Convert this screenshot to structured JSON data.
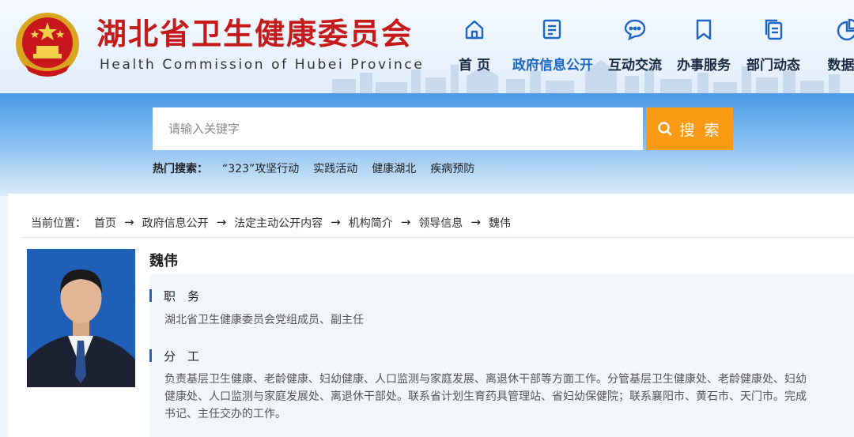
{
  "header": {
    "title_cn": "湖北省卫生健康委员会",
    "title_en": "Health Commission of Hubei Province",
    "brand_color": "#c41a1a"
  },
  "nav": {
    "items": [
      {
        "label": "首 页",
        "icon": "home-icon"
      },
      {
        "label": "政府信息公开",
        "icon": "document-icon",
        "active": true
      },
      {
        "label": "互动交流",
        "icon": "chat-icon"
      },
      {
        "label": "办事服务",
        "icon": "bookmark-icon"
      },
      {
        "label": "部门动态",
        "icon": "copy-icon"
      },
      {
        "label": "数据开",
        "icon": "pie-chart-icon"
      }
    ],
    "accent_color": "#1d66c6"
  },
  "search": {
    "placeholder": "请输入关键字",
    "button_label": "搜 索",
    "button_color": "#fa9a14",
    "hot_label": "热门搜索：",
    "hot_terms": [
      "“323”攻坚行动",
      "实践活动",
      "健康湖北",
      "疾病预防"
    ]
  },
  "breadcrumb": {
    "label": "当前位置：",
    "items": [
      "首页",
      "政府信息公开",
      "法定主动公开内容",
      "机构简介",
      "领导信息",
      "魏伟"
    ]
  },
  "profile": {
    "name": "魏伟",
    "duty_title": "职　务",
    "duty_text": "湖北省卫生健康委员会党组成员、副主任",
    "division_title": "分　工",
    "division_lines": [
      "负责基层卫生健康、老龄健康、妇幼健康、人口监测与家庭发展、离退休干部等方面工作。分管基层卫生健康处、老龄健康处、妇幼",
      "健康处、人口监测与家庭发展处、离退休干部处。联系省计划生育药具管理站、省妇幼保健院；联系襄阳市、黄石市、天门市。完成",
      "书记、主任交办的工作。"
    ]
  }
}
